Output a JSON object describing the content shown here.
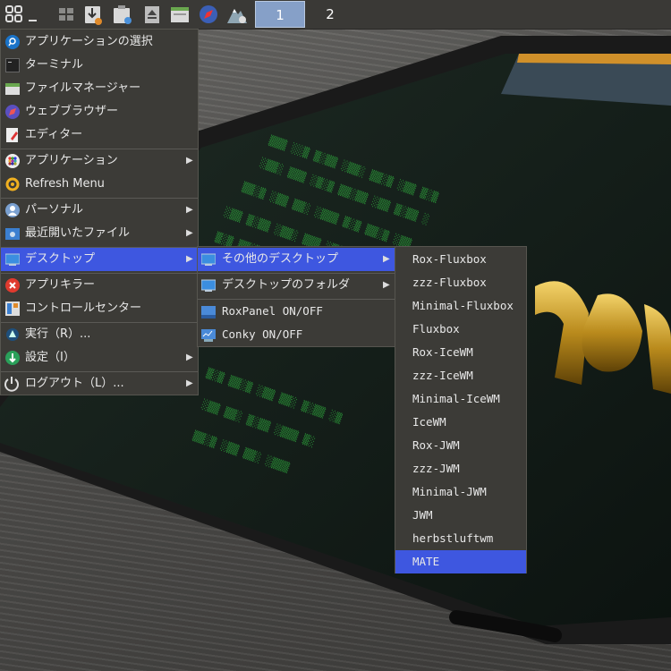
{
  "taskbar": {
    "icons": [
      "menu-grid-icon",
      "minimize-underscore-icon",
      "show-desktop-icon",
      "downloads-icon",
      "clipboard-icon",
      "eject-icon",
      "file-manager-icon",
      "browser-icon",
      "system-monitor-icon"
    ],
    "workspaces": [
      "1",
      "2"
    ],
    "active_workspace": "1"
  },
  "main_menu": {
    "items": [
      {
        "label": "アプリケーションの選択",
        "icon": "search-icon"
      },
      {
        "label": "ターミナル",
        "icon": "terminal-icon"
      },
      {
        "label": "ファイルマネージャー",
        "icon": "file-manager-icon"
      },
      {
        "label": "ウェブブラウザー",
        "icon": "web-browser-icon"
      },
      {
        "label": "エディター",
        "icon": "editor-icon"
      },
      {
        "label": "アプリケーション",
        "icon": "applications-grid-icon",
        "submenu": true
      },
      {
        "label": "Refresh Menu",
        "icon": "refresh-icon"
      },
      {
        "label": "パーソナル",
        "icon": "user-icon",
        "submenu": true
      },
      {
        "label": "最近開いたファイル",
        "icon": "recent-files-icon",
        "submenu": true
      },
      {
        "label": "デスクトップ",
        "icon": "desktop-icon",
        "submenu": true,
        "highlighted": true
      },
      {
        "label": "アプリキラー",
        "icon": "app-killer-icon"
      },
      {
        "label": "コントロールセンター",
        "icon": "control-center-icon"
      },
      {
        "label": "実行（R）...",
        "icon": "run-icon"
      },
      {
        "label": "設定（I）",
        "icon": "settings-icon",
        "submenu": true
      },
      {
        "label": "ログアウト（L）...",
        "icon": "power-icon",
        "submenu": true
      }
    ]
  },
  "desktop_menu": {
    "items": [
      {
        "label": "その他のデスクトップ",
        "submenu": true,
        "highlighted": true
      },
      {
        "label": "デスクトップのフォルダ",
        "submenu": true
      },
      {
        "label": "RoxPanel ON/OFF"
      },
      {
        "label": "Conky ON/OFF"
      }
    ]
  },
  "other_desktops_menu": {
    "items": [
      "Rox-Fluxbox",
      "zzz-Fluxbox",
      "Minimal-Fluxbox",
      "Fluxbox",
      "Rox-IceWM",
      "zzz-IceWM",
      "Minimal-IceWM",
      "IceWM",
      "Rox-JWM",
      "zzz-JWM",
      "Minimal-JWM",
      "JWM",
      "herbstluftwm",
      "MATE"
    ],
    "highlighted": "MATE"
  },
  "colors": {
    "highlight": "#3e57e0",
    "menu_bg": "#3c3b37",
    "panel_bg": "#3a3936"
  }
}
